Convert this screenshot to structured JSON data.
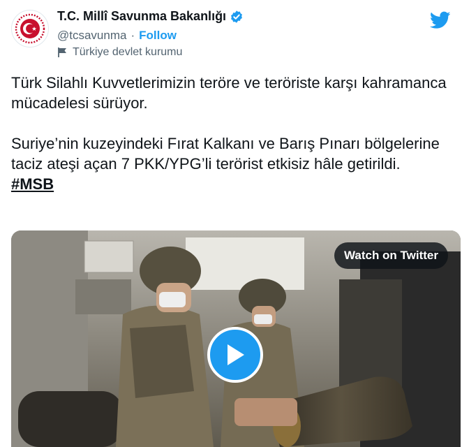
{
  "account": {
    "display_name": "T.C. Millî Savunma Bakanlığı",
    "handle": "@tcsavunma",
    "separator": "·",
    "follow_label": "Follow",
    "account_label": "Türkiye devlet kurumu",
    "avatar_icon": "turkish-ministry-emblem-icon",
    "verified_icon": "verified-badge-icon"
  },
  "tweet": {
    "paragraph1": "Türk Silahlı Kuvvetlerimizin teröre ve teröriste karşı kahramanca mücadelesi sürüyor.",
    "paragraph2": "Suriye’nin kuzeyindeki Fırat Kalkanı ve Barış Pınarı bölgelerine taciz ateşi açan 7 PKK/YPG’li terörist etkisiz hâle getirildi.",
    "hashtag": "#MSB"
  },
  "media": {
    "watch_label": "Watch on Twitter",
    "play_icon": "play-icon"
  },
  "colors": {
    "brand": "#1d9bf0",
    "text": "#0f1419",
    "secondary": "#536471",
    "emblem_red": "#c8102e"
  }
}
